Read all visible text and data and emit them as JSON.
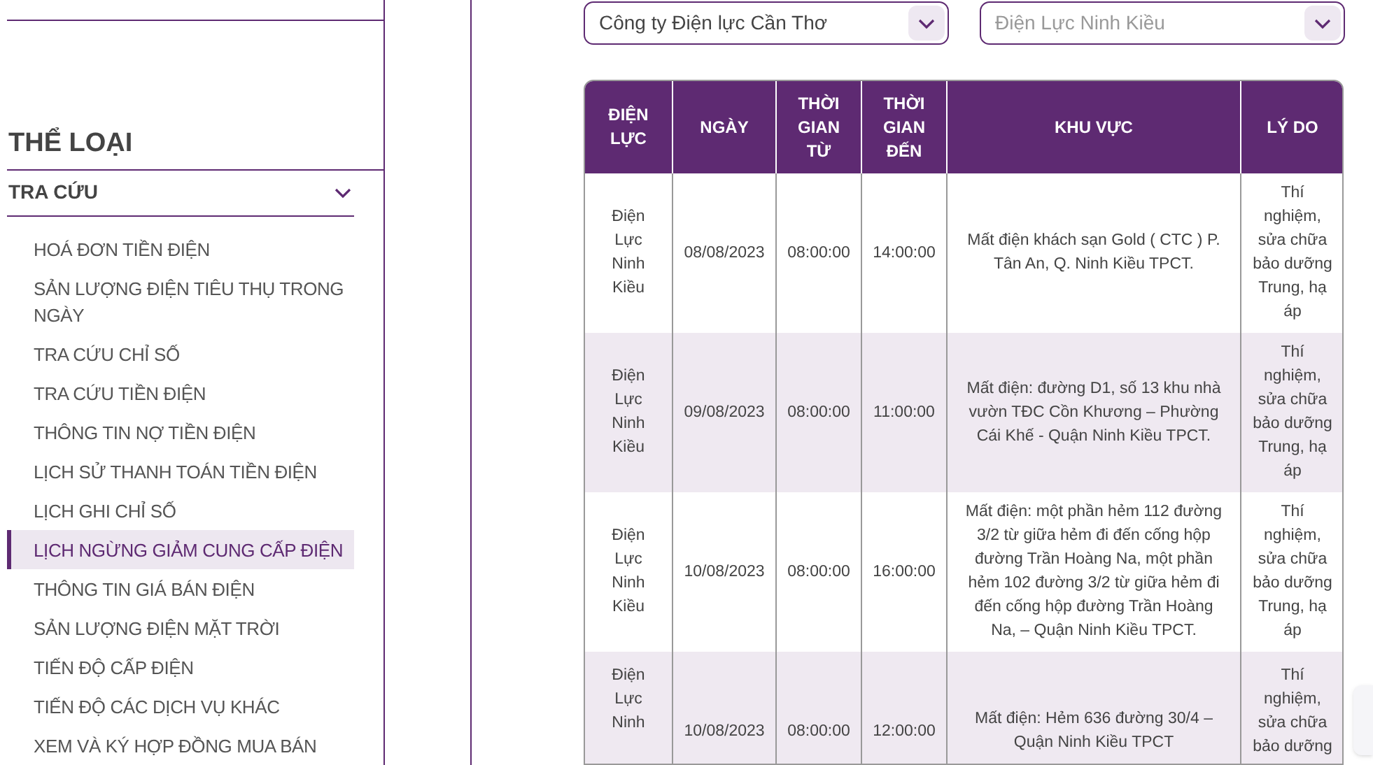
{
  "sidebar": {
    "heading": "THỂ LOẠI",
    "group": {
      "label": "TRA CỨU",
      "expanded": true
    },
    "items": [
      {
        "label": "HOÁ ĐƠN TIỀN ĐIỆN",
        "selected": false
      },
      {
        "label": "SẢN LƯỢNG ĐIỆN TIÊU THỤ TRONG NGÀY",
        "selected": false
      },
      {
        "label": "TRA CỨU CHỈ SỐ",
        "selected": false
      },
      {
        "label": "TRA CỨU TIỀN ĐIỆN",
        "selected": false
      },
      {
        "label": "THÔNG TIN NỢ TIỀN ĐIỆN",
        "selected": false
      },
      {
        "label": "LỊCH SỬ THANH TOÁN TIỀN ĐIỆN",
        "selected": false
      },
      {
        "label": "LỊCH GHI CHỈ SỐ",
        "selected": false
      },
      {
        "label": "LỊCH NGỪNG GIẢM CUNG CẤP ĐIỆN",
        "selected": true
      },
      {
        "label": "THÔNG TIN GIÁ BÁN ĐIỆN",
        "selected": false
      },
      {
        "label": "SẢN LƯỢNG ĐIỆN MẶT TRỜI",
        "selected": false
      },
      {
        "label": "TIẾN ĐỘ CẤP ĐIỆN",
        "selected": false
      },
      {
        "label": "TIẾN ĐỘ CÁC DỊCH VỤ KHÁC",
        "selected": false
      },
      {
        "label": "XEM VÀ KÝ HỢP ĐỒNG MUA BÁN",
        "selected": false
      }
    ]
  },
  "filters": [
    {
      "value": "Công ty Điện lực Cần Thơ"
    },
    {
      "placeholder": "Điện Lực Ninh Kiều"
    }
  ],
  "table": {
    "columns": [
      "ĐIỆN LỰC",
      "NGÀY",
      "THỜI GIAN TỪ",
      "THỜI GIAN ĐẾN",
      "KHU VỰC",
      "LÝ DO"
    ],
    "rows": [
      [
        "Điện Lực Ninh Kiều",
        "08/08/2023",
        "08:00:00",
        "14:00:00",
        "Mất điện khách sạn Gold ( CTC ) P. Tân An, Q. Ninh Kiều TPCT.",
        "Thí nghiệm, sửa chữa bảo dưỡng Trung, hạ áp"
      ],
      [
        "Điện Lực Ninh Kiều",
        "09/08/2023",
        "08:00:00",
        "11:00:00",
        "Mất điện: đường D1, số 13 khu nhà vườn TĐC Cồn Khương – Phường Cái Khế - Quận Ninh Kiều TPCT.",
        "Thí nghiệm, sửa chữa bảo dưỡng Trung, hạ áp"
      ],
      [
        "Điện Lực Ninh Kiều",
        "10/08/2023",
        "08:00:00",
        "16:00:00",
        "Mất điện: một phần hẻm 112 đường 3/2 từ giữa hẻm đi đến cống hộp đường Trần Hoàng Na, một phần hẻm 102 đường 3/2 từ giữa hẻm đi đến cống hộp đường Trần Hoàng Na, – Quận Ninh Kiều TPCT.",
        "Thí nghiệm, sửa chữa bảo dưỡng Trung, hạ áp"
      ],
      [
        "Điện Lực Ninh",
        "10/08/2023",
        "08:00:00",
        "12:00:00",
        "Mất điện: Hẻm 636 đường 30/4 – Quận Ninh Kiều TPCT",
        "Thí nghiệm, sửa chữa bảo dưỡng"
      ]
    ]
  }
}
